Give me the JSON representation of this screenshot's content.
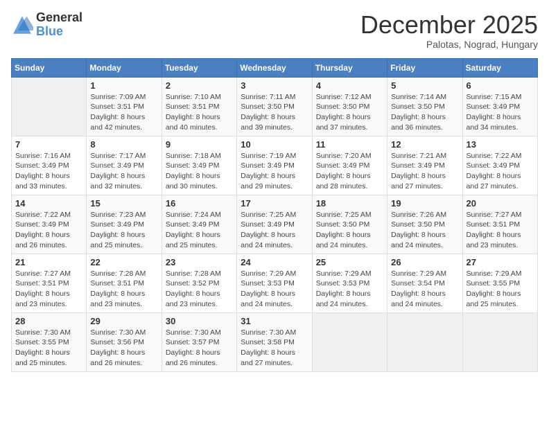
{
  "header": {
    "logo_general": "General",
    "logo_blue": "Blue",
    "month_title": "December 2025",
    "subtitle": "Palotas, Nograd, Hungary"
  },
  "calendar": {
    "days_of_week": [
      "Sunday",
      "Monday",
      "Tuesday",
      "Wednesday",
      "Thursday",
      "Friday",
      "Saturday"
    ],
    "weeks": [
      [
        {
          "day": "",
          "info": ""
        },
        {
          "day": "1",
          "info": "Sunrise: 7:09 AM\nSunset: 3:51 PM\nDaylight: 8 hours\nand 42 minutes."
        },
        {
          "day": "2",
          "info": "Sunrise: 7:10 AM\nSunset: 3:51 PM\nDaylight: 8 hours\nand 40 minutes."
        },
        {
          "day": "3",
          "info": "Sunrise: 7:11 AM\nSunset: 3:50 PM\nDaylight: 8 hours\nand 39 minutes."
        },
        {
          "day": "4",
          "info": "Sunrise: 7:12 AM\nSunset: 3:50 PM\nDaylight: 8 hours\nand 37 minutes."
        },
        {
          "day": "5",
          "info": "Sunrise: 7:14 AM\nSunset: 3:50 PM\nDaylight: 8 hours\nand 36 minutes."
        },
        {
          "day": "6",
          "info": "Sunrise: 7:15 AM\nSunset: 3:49 PM\nDaylight: 8 hours\nand 34 minutes."
        }
      ],
      [
        {
          "day": "7",
          "info": "Sunrise: 7:16 AM\nSunset: 3:49 PM\nDaylight: 8 hours\nand 33 minutes."
        },
        {
          "day": "8",
          "info": "Sunrise: 7:17 AM\nSunset: 3:49 PM\nDaylight: 8 hours\nand 32 minutes."
        },
        {
          "day": "9",
          "info": "Sunrise: 7:18 AM\nSunset: 3:49 PM\nDaylight: 8 hours\nand 30 minutes."
        },
        {
          "day": "10",
          "info": "Sunrise: 7:19 AM\nSunset: 3:49 PM\nDaylight: 8 hours\nand 29 minutes."
        },
        {
          "day": "11",
          "info": "Sunrise: 7:20 AM\nSunset: 3:49 PM\nDaylight: 8 hours\nand 28 minutes."
        },
        {
          "day": "12",
          "info": "Sunrise: 7:21 AM\nSunset: 3:49 PM\nDaylight: 8 hours\nand 27 minutes."
        },
        {
          "day": "13",
          "info": "Sunrise: 7:22 AM\nSunset: 3:49 PM\nDaylight: 8 hours\nand 27 minutes."
        }
      ],
      [
        {
          "day": "14",
          "info": "Sunrise: 7:22 AM\nSunset: 3:49 PM\nDaylight: 8 hours\nand 26 minutes."
        },
        {
          "day": "15",
          "info": "Sunrise: 7:23 AM\nSunset: 3:49 PM\nDaylight: 8 hours\nand 25 minutes."
        },
        {
          "day": "16",
          "info": "Sunrise: 7:24 AM\nSunset: 3:49 PM\nDaylight: 8 hours\nand 25 minutes."
        },
        {
          "day": "17",
          "info": "Sunrise: 7:25 AM\nSunset: 3:49 PM\nDaylight: 8 hours\nand 24 minutes."
        },
        {
          "day": "18",
          "info": "Sunrise: 7:25 AM\nSunset: 3:50 PM\nDaylight: 8 hours\nand 24 minutes."
        },
        {
          "day": "19",
          "info": "Sunrise: 7:26 AM\nSunset: 3:50 PM\nDaylight: 8 hours\nand 24 minutes."
        },
        {
          "day": "20",
          "info": "Sunrise: 7:27 AM\nSunset: 3:51 PM\nDaylight: 8 hours\nand 23 minutes."
        }
      ],
      [
        {
          "day": "21",
          "info": "Sunrise: 7:27 AM\nSunset: 3:51 PM\nDaylight: 8 hours\nand 23 minutes."
        },
        {
          "day": "22",
          "info": "Sunrise: 7:28 AM\nSunset: 3:51 PM\nDaylight: 8 hours\nand 23 minutes."
        },
        {
          "day": "23",
          "info": "Sunrise: 7:28 AM\nSunset: 3:52 PM\nDaylight: 8 hours\nand 23 minutes."
        },
        {
          "day": "24",
          "info": "Sunrise: 7:29 AM\nSunset: 3:53 PM\nDaylight: 8 hours\nand 24 minutes."
        },
        {
          "day": "25",
          "info": "Sunrise: 7:29 AM\nSunset: 3:53 PM\nDaylight: 8 hours\nand 24 minutes."
        },
        {
          "day": "26",
          "info": "Sunrise: 7:29 AM\nSunset: 3:54 PM\nDaylight: 8 hours\nand 24 minutes."
        },
        {
          "day": "27",
          "info": "Sunrise: 7:29 AM\nSunset: 3:55 PM\nDaylight: 8 hours\nand 25 minutes."
        }
      ],
      [
        {
          "day": "28",
          "info": "Sunrise: 7:30 AM\nSunset: 3:55 PM\nDaylight: 8 hours\nand 25 minutes."
        },
        {
          "day": "29",
          "info": "Sunrise: 7:30 AM\nSunset: 3:56 PM\nDaylight: 8 hours\nand 26 minutes."
        },
        {
          "day": "30",
          "info": "Sunrise: 7:30 AM\nSunset: 3:57 PM\nDaylight: 8 hours\nand 26 minutes."
        },
        {
          "day": "31",
          "info": "Sunrise: 7:30 AM\nSunset: 3:58 PM\nDaylight: 8 hours\nand 27 minutes."
        },
        {
          "day": "",
          "info": ""
        },
        {
          "day": "",
          "info": ""
        },
        {
          "day": "",
          "info": ""
        }
      ]
    ]
  }
}
